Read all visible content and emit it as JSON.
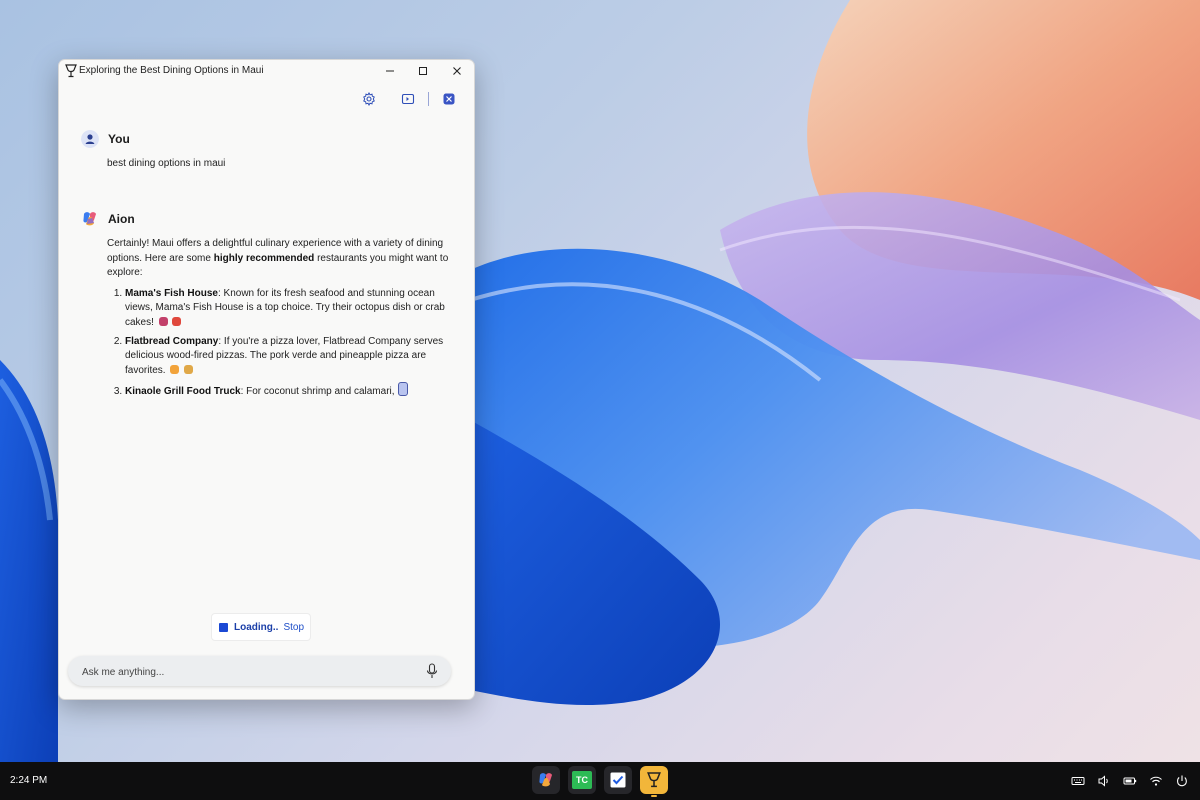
{
  "window": {
    "title": "Exploring the Best Dining Options in Maui"
  },
  "conversation": {
    "user": {
      "name": "You",
      "message": "best dining options in maui"
    },
    "assistant": {
      "name": "Aion",
      "intro_before": "Certainly! Maui offers a delightful culinary experience with a variety of dining options. Here are some ",
      "intro_bold": "highly recommended",
      "intro_after": " restaurants you might want to explore:",
      "items": [
        {
          "name": "Mama's Fish House",
          "text": ": Known for its fresh seafood and stunning ocean views, Mama's Fish House is a top choice. Try their octopus dish or crab cakes!"
        },
        {
          "name": "Flatbread Company",
          "text": ": If you're a pizza lover, Flatbread Company serves delicious wood-fired pizzas. The pork verde and pineapple pizza are favorites."
        },
        {
          "name": "Kinaole Grill Food Truck",
          "text": ": For coconut shrimp and calamari,"
        }
      ]
    }
  },
  "status": {
    "loading_label": "Loading..",
    "stop_label": "Stop"
  },
  "input": {
    "placeholder": "Ask me anything..."
  },
  "taskbar": {
    "time": "2:24 PM",
    "apps": [
      {
        "name": "copilot-app-icon"
      },
      {
        "name": "tc-app-icon",
        "label": "TC"
      },
      {
        "name": "todo-app-icon"
      },
      {
        "name": "goblet-app-icon"
      }
    ],
    "tray": [
      "keyboard-icon",
      "volume-icon",
      "battery-icon",
      "wifi-icon",
      "power-icon"
    ]
  },
  "colors": {
    "accent": "#1b49d4",
    "taskbar": "#0e0e0f",
    "active_app": "#f2b63a"
  }
}
